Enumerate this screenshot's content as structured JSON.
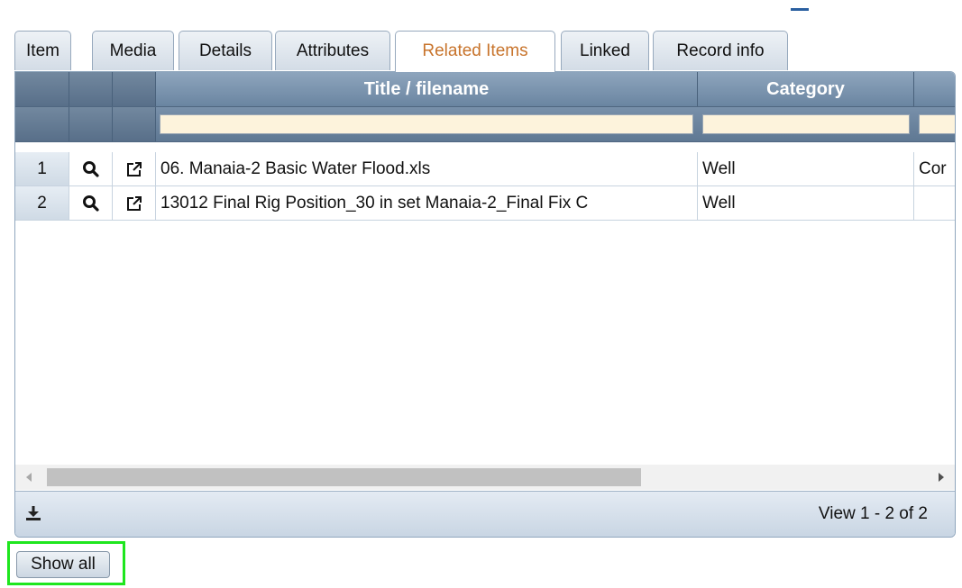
{
  "tabs": [
    {
      "label": "Item"
    },
    {
      "label": "Media"
    },
    {
      "label": "Details"
    },
    {
      "label": "Attributes"
    },
    {
      "label": "Related Items",
      "active": true
    },
    {
      "label": "Linked"
    },
    {
      "label": "Record info"
    }
  ],
  "grid": {
    "columns": [
      "",
      "",
      "",
      "Title / filename",
      "Category",
      ""
    ],
    "rows": [
      {
        "num": "1",
        "title": "06. Manaia-2 Basic Water Flood.xls",
        "category": "Well",
        "extra": "Cor"
      },
      {
        "num": "2",
        "title": "13012 Final Rig Position_30 in set Manaia-2_Final Fix C",
        "category": "Well",
        "extra": ""
      }
    ],
    "pager_text": "View 1 - 2 of 2"
  },
  "buttons": {
    "show_all": "Show all"
  },
  "icons": {
    "view": "magnifier-icon",
    "open": "external-link-icon",
    "download": "download-icon"
  },
  "colors": {
    "active_tab_text": "#c8742c",
    "highlight_border": "#1ee61e"
  }
}
